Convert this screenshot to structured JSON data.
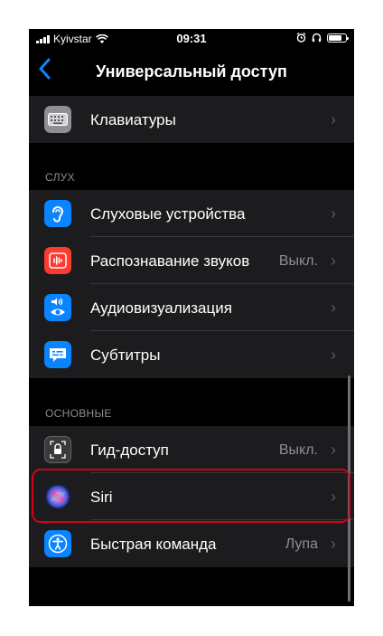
{
  "status_bar": {
    "carrier": "Kyivstar",
    "time": "09:31"
  },
  "nav": {
    "title": "Универсальный доступ",
    "back_icon": "chevron-left-icon"
  },
  "top_group": {
    "items": [
      {
        "label": "Клавиатуры",
        "icon": "keyboard-icon",
        "icon_color": "#8e8e93"
      }
    ]
  },
  "hearing": {
    "header": "СЛУХ",
    "items": [
      {
        "label": "Слуховые устройства",
        "icon": "ear-icon",
        "icon_color": "#0a84ff"
      },
      {
        "label": "Распознавание звуков",
        "value": "Выкл.",
        "icon": "sound-recognition-icon",
        "icon_color": "#ff3b30"
      },
      {
        "label": "Аудиовизуализация",
        "icon": "audio-visual-icon",
        "icon_color": "#0a84ff"
      },
      {
        "label": "Субтитры",
        "icon": "subtitles-icon",
        "icon_color": "#0a84ff"
      }
    ]
  },
  "general": {
    "header": "ОСНОВНЫЕ",
    "items": [
      {
        "label": "Гид-доступ",
        "value": "Выкл.",
        "icon": "lock-icon",
        "icon_color": "#3a3a3c"
      },
      {
        "label": "Siri",
        "icon": "siri-icon",
        "icon_color": "#1c1c2e"
      },
      {
        "label": "Быстрая команда",
        "value": "Лупа",
        "icon": "accessibility-icon",
        "icon_color": "#0a84ff"
      }
    ]
  },
  "colors": {
    "accent": "#0a84ff",
    "highlight": "#d0021b"
  }
}
